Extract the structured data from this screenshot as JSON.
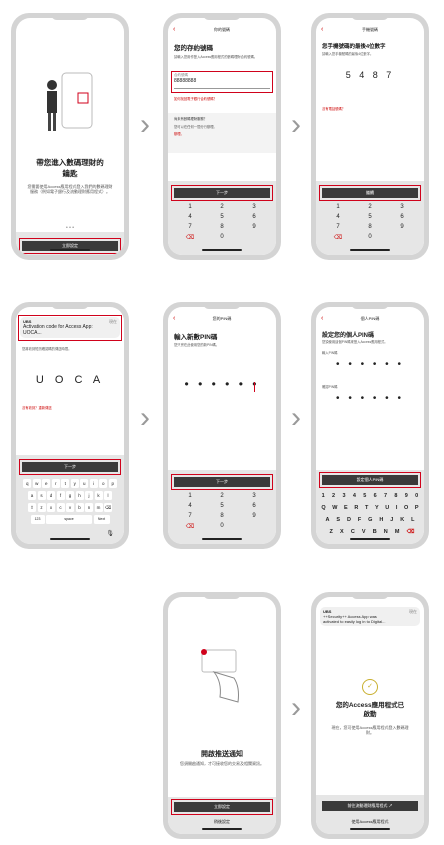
{
  "screens": {
    "s1": {
      "title_line1": "帶您進入數碼理財的",
      "title_line2": "鑰匙",
      "desc": "您需要使用Access應用程式登入我們的數碼理財服務（例如電子銀行及流動理財應用程式）。",
      "dots": "• • •",
      "button": "立即設定"
    },
    "s2": {
      "nav_title": "你的號碼",
      "heading": "您的存約號碼",
      "desc": "請輸入您用作登入Access應用程式的數碼理財合約號碼。",
      "field_label": "合約號碼",
      "field_value": "88888888",
      "forgot_link": "如何找回電子銀行合約號碼？",
      "note_title": "尚未有數碼理財服務？",
      "note_text": "您可以在任何一間分行辦理。",
      "note_link": "辦理。",
      "button": "下一步",
      "keypad": [
        "1",
        "2",
        "3",
        "4",
        "5",
        "6",
        "7",
        "8",
        "9",
        "⌫",
        "0",
        ""
      ]
    },
    "s3": {
      "nav_title": "手機號碼",
      "heading": "您手機號碼的最後4位數字",
      "desc": "請輸入您手機號碼的最後4位數字。",
      "digits": "5 4 8 7",
      "link": "沒有電話號碼？",
      "button": "繼續",
      "keypad": [
        "1",
        "2",
        "3",
        "4",
        "5",
        "6",
        "7",
        "8",
        "9",
        "⌫",
        "0",
        ""
      ]
    },
    "s4": {
      "notif_app": "UBS",
      "notif_time": "現在",
      "notif_line1": "Activation code for Access App:",
      "notif_line2": "UOCA...",
      "desc": "您將收到短訊確認碼的傳送時間。",
      "code": "U O C A",
      "link": "沒有收到？重新傳送",
      "button": "下一步",
      "kb_row1": [
        "q",
        "w",
        "e",
        "r",
        "t",
        "y",
        "u",
        "i",
        "o",
        "p"
      ],
      "kb_row2": [
        "a",
        "s",
        "d",
        "f",
        "g",
        "h",
        "j",
        "k",
        "l"
      ],
      "kb_row3": [
        "⇧",
        "z",
        "x",
        "c",
        "v",
        "b",
        "n",
        "m",
        "⌫"
      ],
      "kb_row4": [
        "123",
        "space",
        "Next"
      ]
    },
    "s5": {
      "nav_title": "您的PIN碼",
      "heading": "輸入新數PIN碼",
      "desc": "您只會在此使用您的新PIN碼。",
      "dots": "• • • • • •",
      "button": "下一步",
      "keypad": [
        "1",
        "2",
        "3",
        "4",
        "5",
        "6",
        "7",
        "8",
        "9",
        "⌫",
        "0",
        ""
      ]
    },
    "s6": {
      "nav_title": "個人PIN碼",
      "heading": "設定您的個人PIN碼",
      "desc": "您須使用這個PIN碼來登入Access應用程式。",
      "field1_label": "輸入PIN碼",
      "field2_label": "確認PIN碼",
      "dots": "• • • • • •",
      "button": "設定個人PIN碼",
      "row_num": [
        "1",
        "2",
        "3",
        "4",
        "5",
        "6",
        "7",
        "8",
        "9",
        "0"
      ],
      "row_q": [
        "Q",
        "W",
        "E",
        "R",
        "T",
        "Y",
        "U",
        "I",
        "O",
        "P"
      ],
      "row_a": [
        "A",
        "S",
        "D",
        "F",
        "G",
        "H",
        "J",
        "K",
        "L"
      ],
      "row_z": [
        "Z",
        "X",
        "C",
        "V",
        "B",
        "N",
        "M",
        "⌫"
      ]
    },
    "s7": {
      "heading": "開啟推送通知",
      "desc": "您須開啟通知，才可接收您的交易及相關資訊。",
      "button": "立即設定",
      "secondary": "稍後設定"
    },
    "s8": {
      "notif_app": "UBS",
      "notif_time": "現在",
      "notif_line1": "++Security++ Access App was",
      "notif_line2": "activated to easily log in to Digital...",
      "heading_line1": "您的Access應用程式已",
      "heading_line2": "啟動",
      "desc": "現在，您可使用Access應用程式登入數碼理財。",
      "button": "前往流動理財應用程式 ↗",
      "secondary": "使用Access應用程式"
    }
  },
  "arrow": "›",
  "accent": "#d0021b"
}
